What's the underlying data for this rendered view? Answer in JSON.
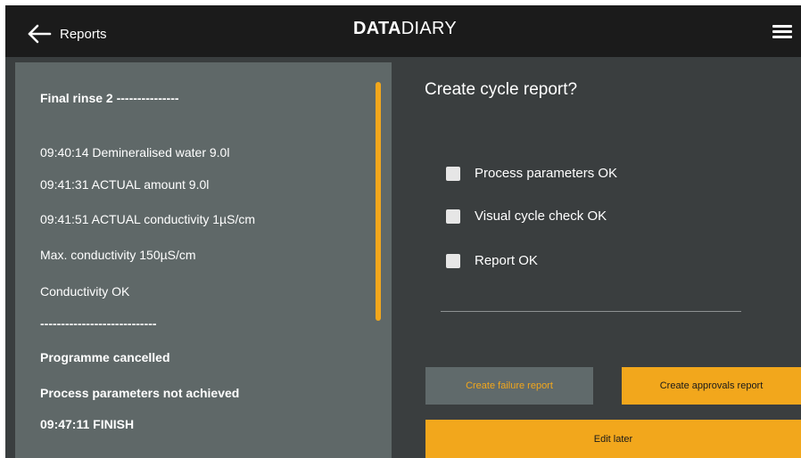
{
  "header": {
    "back_label": "Reports",
    "logo_bold": "DATA",
    "logo_light": "DIARY"
  },
  "log": {
    "lines": [
      {
        "text": "Final rinse 2 ---------------",
        "bold": true
      },
      {
        "text": "09:40:14 Demineralised water 9.0l",
        "bold": false
      },
      {
        "text": "09:41:31 ACTUAL amount 9.0l",
        "bold": false
      },
      {
        "text": "09:41:51 ACTUAL conductivity 1µS/cm",
        "bold": false
      },
      {
        "text": "Max. conductivity 150µS/cm",
        "bold": false
      },
      {
        "text": "Conductivity OK",
        "bold": false
      },
      {
        "text": "----------------------------",
        "bold": true
      },
      {
        "text": "Programme cancelled",
        "bold": true
      },
      {
        "text": "Process parameters not achieved",
        "bold": true
      },
      {
        "text": "09:47:11 FINISH",
        "bold": true
      }
    ]
  },
  "dialog": {
    "question": "Create cycle report?",
    "checks": [
      {
        "label": "Process parameters OK",
        "checked": false
      },
      {
        "label": "Visual cycle check OK",
        "checked": false
      },
      {
        "label": "Report OK",
        "checked": false
      }
    ]
  },
  "buttons": {
    "failure": "Create failure report",
    "approvals": "Create approvals report",
    "edit_later": "Edit later"
  },
  "colors": {
    "accent": "#f2a71c",
    "topbar": "#1b1b1b",
    "background": "#3a3e3f",
    "panel": "#5f6868"
  }
}
